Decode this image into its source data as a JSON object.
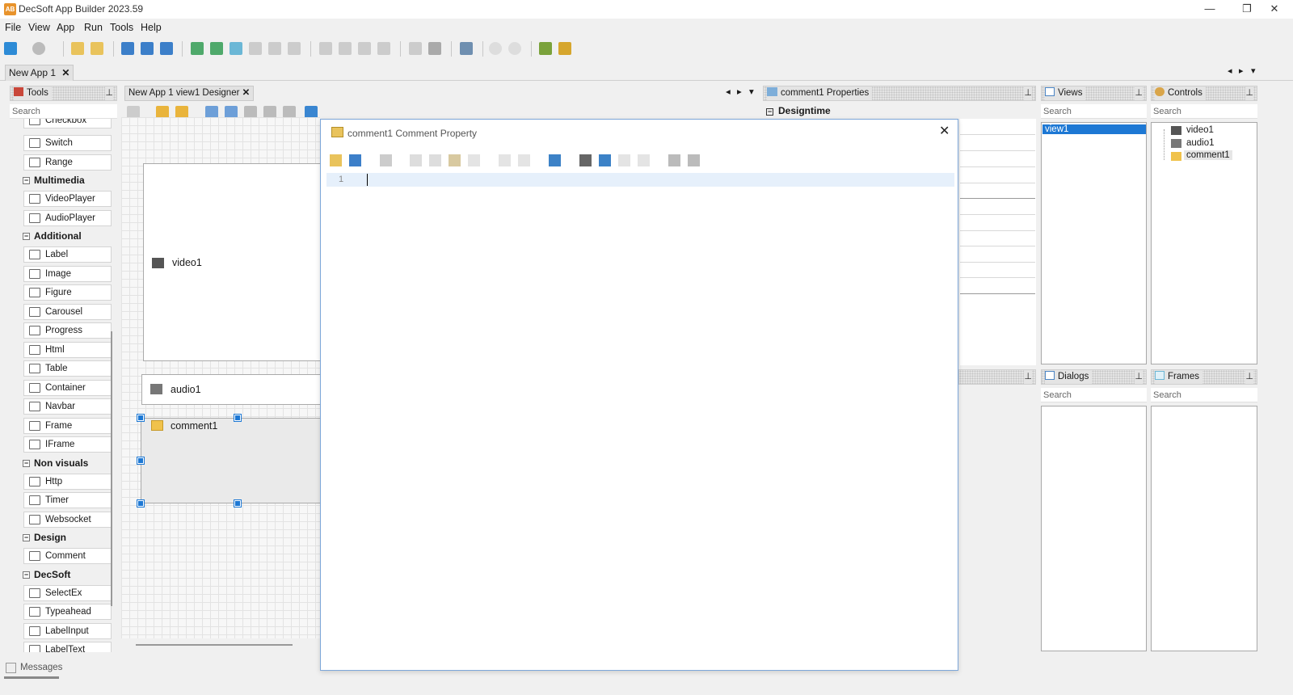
{
  "window": {
    "title": "DecSoft App Builder 2023.59",
    "app_icon_text": "AB",
    "minimize_glyph": "—",
    "maximize_glyph": "❐",
    "close_glyph": "✕"
  },
  "menu": [
    "File",
    "View",
    "App",
    "Run",
    "Tools",
    "Help"
  ],
  "doc_tabs": {
    "active": "New App 1",
    "close_glyph": "✕",
    "nav_left": "◂",
    "nav_right": "▸",
    "nav_menu": "▾"
  },
  "tools": {
    "header": "Tools",
    "search_placeholder": "Search",
    "items": [
      {
        "type": "tool",
        "label": "Checkbox",
        "icon": "checkbox-icon"
      },
      {
        "type": "tool",
        "label": "Switch",
        "icon": "switch-icon"
      },
      {
        "type": "tool",
        "label": "Range",
        "icon": "range-icon"
      },
      {
        "type": "cat",
        "label": "Multimedia"
      },
      {
        "type": "tool",
        "label": "VideoPlayer",
        "icon": "film-icon"
      },
      {
        "type": "tool",
        "label": "AudioPlayer",
        "icon": "speaker-icon"
      },
      {
        "type": "cat",
        "label": "Additional"
      },
      {
        "type": "tool",
        "label": "Label",
        "icon": "text-icon"
      },
      {
        "type": "tool",
        "label": "Image",
        "icon": "image-icon"
      },
      {
        "type": "tool",
        "label": "Figure",
        "icon": "figure-icon"
      },
      {
        "type": "tool",
        "label": "Carousel",
        "icon": "carousel-icon"
      },
      {
        "type": "tool",
        "label": "Progress",
        "icon": "progress-icon"
      },
      {
        "type": "tool",
        "label": "Html",
        "icon": "html-icon"
      },
      {
        "type": "tool",
        "label": "Table",
        "icon": "table-icon"
      },
      {
        "type": "tool",
        "label": "Container",
        "icon": "container-icon"
      },
      {
        "type": "tool",
        "label": "Navbar",
        "icon": "navbar-icon"
      },
      {
        "type": "tool",
        "label": "Frame",
        "icon": "frame-icon"
      },
      {
        "type": "tool",
        "label": "IFrame",
        "icon": "iframe-icon"
      },
      {
        "type": "cat",
        "label": "Non visuals"
      },
      {
        "type": "tool",
        "label": "Http",
        "icon": "http-icon"
      },
      {
        "type": "tool",
        "label": "Timer",
        "icon": "timer-icon"
      },
      {
        "type": "tool",
        "label": "Websocket",
        "icon": "websocket-icon"
      },
      {
        "type": "cat",
        "label": "Design"
      },
      {
        "type": "tool",
        "label": "Comment",
        "icon": "comment-icon"
      },
      {
        "type": "cat",
        "label": "DecSoft"
      },
      {
        "type": "tool",
        "label": "SelectEx",
        "icon": "select-icon"
      },
      {
        "type": "tool",
        "label": "Typeahead",
        "icon": "typeahead-icon"
      },
      {
        "type": "tool",
        "label": "LabelInput",
        "icon": "labelinput-icon"
      },
      {
        "type": "tool",
        "label": "LabelText",
        "icon": "labeltext-icon"
      }
    ],
    "collapse_glyph": "−"
  },
  "designer": {
    "tab_label": "New App 1 view1 Designer",
    "controls": {
      "video": "video1",
      "audio": "audio1",
      "comment": "comment1"
    }
  },
  "properties": {
    "header": "comment1 Properties",
    "section": "Designtime"
  },
  "views": {
    "header": "Views",
    "search_placeholder": "Search",
    "items": [
      "view1"
    ]
  },
  "controls_panel": {
    "header": "Controls",
    "search_placeholder": "Search",
    "items": [
      "video1",
      "audio1",
      "comment1"
    ]
  },
  "dialogs": {
    "header": "Dialogs",
    "search_placeholder": "Search"
  },
  "frames": {
    "header": "Frames",
    "search_placeholder": "Search"
  },
  "pin_glyph": "⊥",
  "editor_dialog": {
    "title": "comment1 Comment Property",
    "close_glyph": "✕",
    "line_number": "1"
  },
  "status": {
    "messages_label": "Messages"
  }
}
